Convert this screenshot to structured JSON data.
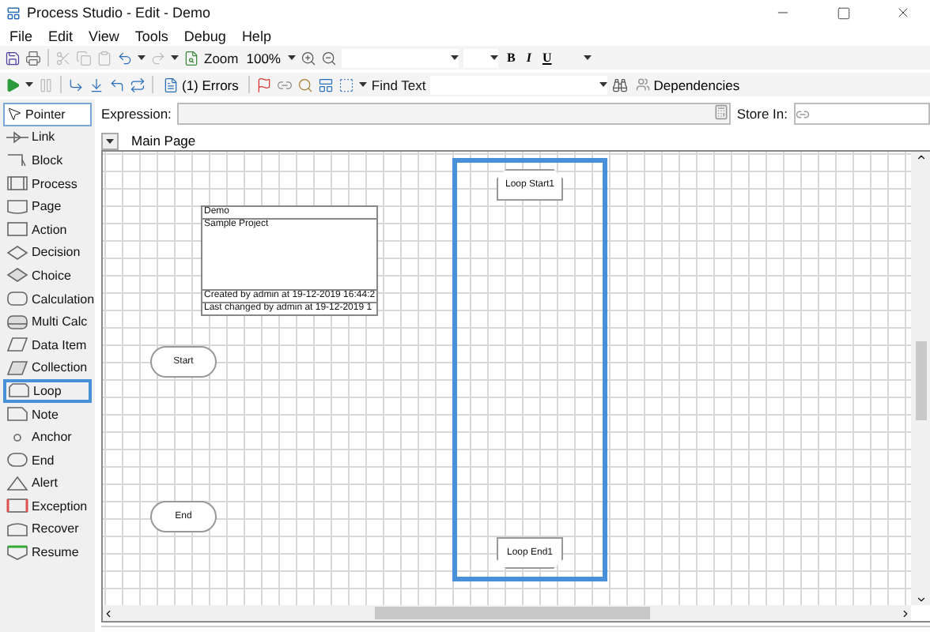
{
  "window": {
    "title": "Process Studio  - Edit - Demo"
  },
  "menu": [
    "File",
    "Edit",
    "View",
    "Tools",
    "Debug",
    "Help"
  ],
  "toolbar_top": {
    "zoom_label": "Zoom",
    "zoom_value": "100%",
    "bold": "B",
    "italic": "I",
    "underline": "U"
  },
  "toolbar_bottom": {
    "errors": "(1) Errors",
    "find_label": "Find Text",
    "dependencies": "Dependencies"
  },
  "palette": [
    {
      "label": "Pointer",
      "active": true,
      "selected": false
    },
    {
      "label": "Link",
      "active": false,
      "selected": false
    },
    {
      "label": "Block",
      "active": false,
      "selected": false
    },
    {
      "label": "Process",
      "active": false,
      "selected": false
    },
    {
      "label": "Page",
      "active": false,
      "selected": false
    },
    {
      "label": "Action",
      "active": false,
      "selected": false
    },
    {
      "label": "Decision",
      "active": false,
      "selected": false
    },
    {
      "label": "Choice",
      "active": false,
      "selected": false
    },
    {
      "label": "Calculation",
      "active": false,
      "selected": false
    },
    {
      "label": "Multi Calc",
      "active": false,
      "selected": false
    },
    {
      "label": "Data Item",
      "active": false,
      "selected": false
    },
    {
      "label": "Collection",
      "active": false,
      "selected": false
    },
    {
      "label": "Loop",
      "active": false,
      "selected": true
    },
    {
      "label": "Note",
      "active": false,
      "selected": false
    },
    {
      "label": "Anchor",
      "active": false,
      "selected": false
    },
    {
      "label": "End",
      "active": false,
      "selected": false
    },
    {
      "label": "Alert",
      "active": false,
      "selected": false
    },
    {
      "label": "Exception",
      "active": false,
      "selected": false
    },
    {
      "label": "Recover",
      "active": false,
      "selected": false
    },
    {
      "label": "Resume",
      "active": false,
      "selected": false
    }
  ],
  "expression": {
    "label": "Expression:",
    "store_label": "Store In:"
  },
  "tabs": [
    {
      "label": "Main Page",
      "selected": true
    }
  ],
  "info_box": {
    "title": "Demo",
    "description": "Sample Project",
    "created": "Created  by  admin  at  19-12-2019 16:44:2",
    "changed": "Last changed by admin at 19-12-2019 1"
  },
  "stages": [
    {
      "kind": "terminal",
      "label": "Start"
    },
    {
      "kind": "terminal",
      "label": "End"
    },
    {
      "kind": "loop_start",
      "label": "Loop Start1"
    },
    {
      "kind": "loop_end",
      "label": "Loop End1"
    }
  ],
  "loop_highlight": true
}
